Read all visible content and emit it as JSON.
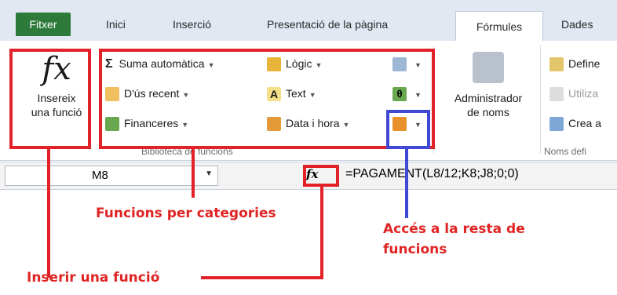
{
  "tabs": {
    "file": "Fitxer",
    "items": [
      "Inici",
      "Inserció",
      "Presentació de la pàgina"
    ],
    "active": "Fórmules",
    "next": "Dades"
  },
  "ribbon": {
    "insert_function": {
      "symbol": "fx",
      "line1": "Insereix",
      "line2": "una funció"
    },
    "autosum": "Suma automàtica",
    "recent": "D'ús recent",
    "financial": "Financeres",
    "logical": "Lògic",
    "text": "Text",
    "datetime": "Data i hora",
    "name_manager_line1": "Administrador",
    "name_manager_line2": "de noms",
    "define": "Define",
    "use": "Utiliza",
    "create": "Crea a",
    "group_label_library": "Biblioteca de funcions",
    "group_label_names": "Noms defi"
  },
  "formula_bar": {
    "cell_ref": "M8",
    "fx": "fx",
    "formula": "=PAGAMENT(L8/12;K8;J8;0;0)"
  },
  "callouts": {
    "categories": "Funcions per categories",
    "more_line1": "Accés a la resta de",
    "more_line2": "funcions",
    "insert": "Inserir una funció"
  },
  "colors": {
    "annotation_red": "#e32128",
    "annotation_blue": "#3f49d4",
    "file_tab": "#2d7a3a"
  }
}
